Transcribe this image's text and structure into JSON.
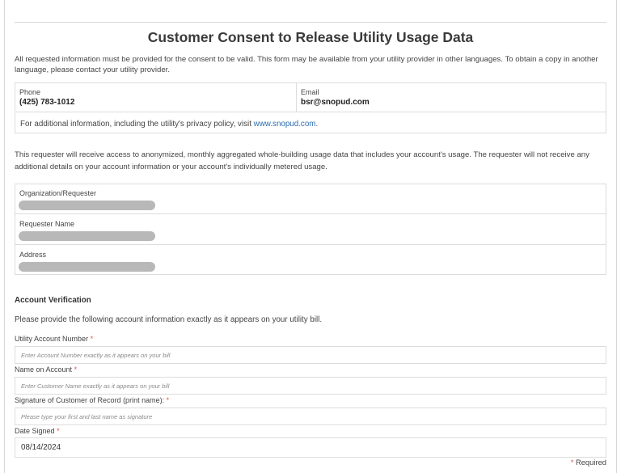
{
  "form": {
    "title": "Customer Consent to Release Utility Usage Data",
    "intro": "All requested information must be provided for the consent to be valid. This form may be available from your utility provider in other languages. To obtain a copy in another language, please contact your utility provider."
  },
  "contact": {
    "phone_label": "Phone",
    "phone_value": "(425) 783-1012",
    "email_label": "Email",
    "email_value": "bsr@snopud.com",
    "info_prefix": "For additional information, including the utility's privacy policy, visit ",
    "info_link": "www.snopud.com",
    "info_suffix": "."
  },
  "requester": {
    "description": "This requester will receive access to anonymized, monthly aggregated whole-building usage data that includes your account's usage. The requester will not receive any additional details on your account information or your account's individually metered usage.",
    "organization_label": "Organization/Requester",
    "name_label": "Requester Name",
    "address_label": "Address"
  },
  "verification": {
    "heading": "Account Verification",
    "instructions": "Please provide the following account information exactly as it appears on your utility bill.",
    "fields": [
      {
        "label": "Utility Account Number",
        "placeholder": "Enter Account Number exactly as it appears on your bill",
        "value": ""
      },
      {
        "label": "Name on Account",
        "placeholder": "Enter Customer Name exactly as it appears on your bill",
        "value": ""
      },
      {
        "label": "Signature of Customer of Record (print name):",
        "placeholder": "Please type your first and last name as signature",
        "value": ""
      },
      {
        "label": "Date Signed",
        "placeholder": "",
        "value": "08/14/2024"
      }
    ],
    "required_star": "*",
    "required_note": "Required"
  },
  "colors": {
    "link": "#2a6db0",
    "required_star": "#d9534f",
    "border": "#dcdcdc",
    "redaction": "#b8b8b8"
  }
}
